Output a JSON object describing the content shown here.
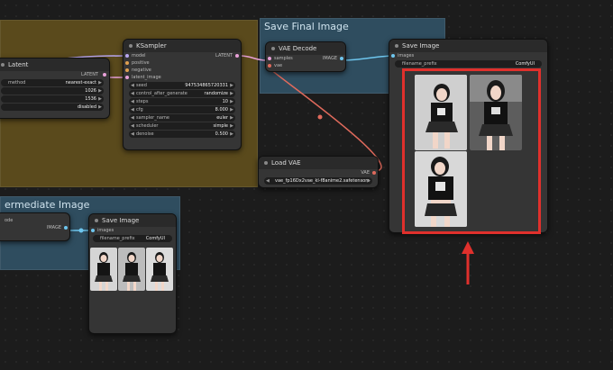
{
  "groups": {
    "sampler_group": {
      "title": ""
    },
    "save_final": {
      "title": "Save Final Image"
    },
    "intermediate": {
      "title": "ermediate Image"
    }
  },
  "latent_node": {
    "title": "Latent",
    "widgets": [
      {
        "label": "method",
        "value": "nearest-exact"
      },
      {
        "label": "",
        "value": "1026"
      },
      {
        "label": "",
        "value": "1536"
      },
      {
        "label": "",
        "value": "disabled"
      }
    ]
  },
  "ksampler": {
    "title": "KSampler",
    "inputs": [
      "model",
      "positive",
      "negative",
      "latent_image"
    ],
    "output": "LATENT",
    "widgets": [
      {
        "label": "seed",
        "value": "947534865720331"
      },
      {
        "label": "control_after_generate",
        "value": "randomize"
      },
      {
        "label": "steps",
        "value": "10"
      },
      {
        "label": "cfg",
        "value": "8.000"
      },
      {
        "label": "sampler_name",
        "value": "euler"
      },
      {
        "label": "scheduler",
        "value": "simple"
      },
      {
        "label": "denoise",
        "value": "0.500"
      }
    ]
  },
  "latent_out_label": "LATENT",
  "vae_decode": {
    "title": "VAE Decode",
    "inputs": [
      "samples",
      "vae"
    ],
    "output": "IMAGE"
  },
  "load_vae": {
    "title": "Load VAE",
    "output": "VAE",
    "widget_value": "vae_fp16Dx2vae_kl-f8anime2.safetensors"
  },
  "save_image_final": {
    "title": "Save Image",
    "input": "images",
    "prefix_label": "filename_prefix",
    "prefix_value": "ComfyUI"
  },
  "intermediate_left": {
    "label": "ode",
    "output": "IMAGE"
  },
  "save_image_small": {
    "title": "Save Image",
    "input": "images",
    "prefix_label": "filename_prefix",
    "prefix_value": "ComfyUI"
  },
  "colors": {
    "sampler_group": "#5a4a1c",
    "blue_group": "#2f4d5f",
    "highlight": "#e0302c",
    "latent_wire": "#e8a0d8",
    "image_wire": "#6ec6ee",
    "vae_wire": "#e06a5c",
    "model_wire": "#b8a6f0"
  }
}
